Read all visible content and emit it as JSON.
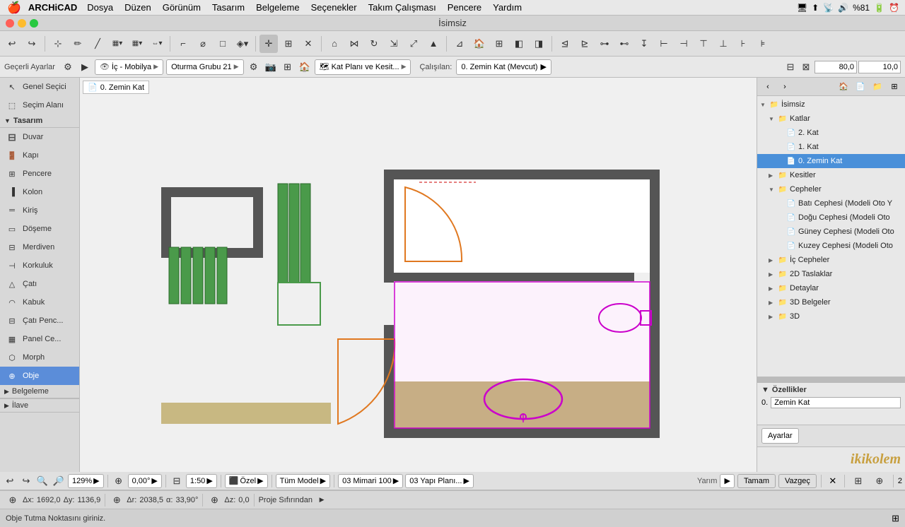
{
  "menubar": {
    "apple": "🍎",
    "app_name": "ARCHiCAD",
    "items": [
      "Dosya",
      "Düzen",
      "Görünüm",
      "Tasarım",
      "Belgeleme",
      "Seçenekler",
      "Takım Çalışması",
      "Pencere",
      "Yardım"
    ],
    "right_icons": [
      "🖥",
      "⬇",
      "📶",
      "🔊",
      "81%",
      "🔋"
    ]
  },
  "title": "İsimsiz",
  "toolbar": {
    "gecel_label": "Geçerli Ayarlar",
    "layer": "İç - Mobilya",
    "group": "Oturma Grubu 21",
    "view": "Kat Planı ve Kesit...",
    "calisan_label": "Çalışılan:",
    "floor": "0. Zemin Kat (Mevcut)",
    "dim1": "80,0",
    "dim2": "10,0"
  },
  "tools": {
    "section1": "Genel Seçici",
    "section2": "Seçim Alanı",
    "section3_header": "Tasarım",
    "items": [
      {
        "id": "duvar",
        "label": "Duvar"
      },
      {
        "id": "kapi",
        "label": "Kapı"
      },
      {
        "id": "pencere",
        "label": "Pencere"
      },
      {
        "id": "kolon",
        "label": "Kolon"
      },
      {
        "id": "kiris",
        "label": "Kiriş"
      },
      {
        "id": "doseme",
        "label": "Döşeme"
      },
      {
        "id": "merdiven",
        "label": "Merdiven"
      },
      {
        "id": "korkuluk",
        "label": "Korkuluk"
      },
      {
        "id": "cati",
        "label": "Çatı"
      },
      {
        "id": "kabuk",
        "label": "Kabuk"
      },
      {
        "id": "cati-penc",
        "label": "Çatı Penc..."
      },
      {
        "id": "panel-ce",
        "label": "Panel Ce..."
      },
      {
        "id": "morph",
        "label": "Morph"
      },
      {
        "id": "obje",
        "label": "Obje"
      },
      {
        "id": "belgeleme",
        "label": "Belgeleme"
      },
      {
        "id": "ilave",
        "label": "İlave"
      }
    ]
  },
  "canvas": {
    "zoom_level": "0. Zemin Kat"
  },
  "tree": {
    "items": [
      {
        "id": "isimsiz",
        "label": "İsimsiz",
        "level": 0,
        "type": "project",
        "open": true
      },
      {
        "id": "katlar",
        "label": "Katlar",
        "level": 1,
        "type": "folder",
        "open": true
      },
      {
        "id": "kat2",
        "label": "2. Kat",
        "level": 2,
        "type": "doc"
      },
      {
        "id": "kat1",
        "label": "1. Kat",
        "level": 2,
        "type": "doc"
      },
      {
        "id": "kat0",
        "label": "0. Zemin Kat",
        "level": 2,
        "type": "doc",
        "selected": true
      },
      {
        "id": "kesitler",
        "label": "Kesitler",
        "level": 1,
        "type": "folder"
      },
      {
        "id": "cepheler",
        "label": "Cepheler",
        "level": 1,
        "type": "folder",
        "open": true
      },
      {
        "id": "bati",
        "label": "Batı Cephesi (Modeli Oto Y",
        "level": 2,
        "type": "doc"
      },
      {
        "id": "dogu",
        "label": "Doğu Cephesi (Modeli Oto",
        "level": 2,
        "type": "doc"
      },
      {
        "id": "guney",
        "label": "Güney Cephesi (Modeli Oto",
        "level": 2,
        "type": "doc"
      },
      {
        "id": "kuzey",
        "label": "Kuzey Cephesi (Modeli Oto",
        "level": 2,
        "type": "doc"
      },
      {
        "id": "ic-cepheler",
        "label": "İç Cepheler",
        "level": 1,
        "type": "folder2"
      },
      {
        "id": "2d-taslaklar",
        "label": "2D Taslaklar",
        "level": 1,
        "type": "folder2"
      },
      {
        "id": "detaylar",
        "label": "Detaylar",
        "level": 1,
        "type": "folder"
      },
      {
        "id": "3d-belgeler",
        "label": "3D Belgeler",
        "level": 1,
        "type": "folder"
      },
      {
        "id": "3d",
        "label": "3D",
        "level": 1,
        "type": "folder",
        "open": false
      }
    ]
  },
  "properties": {
    "header": "Özellikler",
    "floor_label": "0.",
    "floor_value": "Zemin Kat",
    "settings_label": "Ayarlar"
  },
  "bottom_toolbar": {
    "undo": "↩",
    "redo": "↪",
    "zoom_in": "🔍+",
    "zoom_out": "🔍-",
    "zoom_level": "129%",
    "angle": "0,00°",
    "scale_label": "1:50",
    "layer_dropdown": "Özel",
    "model_dropdown": "Tüm Model",
    "floor_dropdown": "03 Mimari 100",
    "plan_dropdown": "03 Yapı Planı...",
    "actions": {
      "yarim": "Yarım",
      "tamam": "Tamam",
      "vazgec": "Vazgeç",
      "count": "2"
    }
  },
  "coordinates": {
    "ax_label": "Δx:",
    "ax_value": "1692,0",
    "ay_label": "Δy:",
    "ay_value": "1136,9",
    "ar_label": "Δr:",
    "ar_value": "2038,5",
    "aa_label": "α:",
    "aa_value": "33,90°",
    "az_label": "Δz:",
    "az_value": "0,0",
    "ref_label": "Proje Sıfırından"
  },
  "status_message": "Obje Tutma Noktasını giriniz.",
  "watermark": "ikikolem"
}
